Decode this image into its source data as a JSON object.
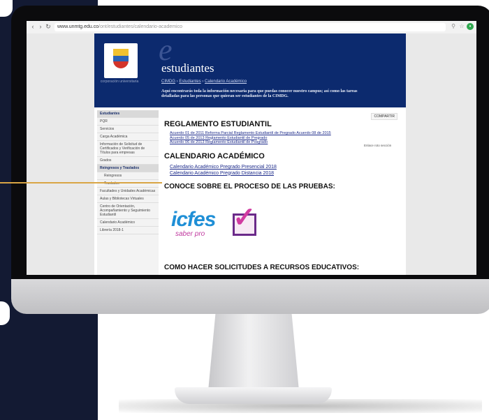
{
  "browser": {
    "url_domain": "www.unmtg.edu.co",
    "url_path": "/ont/estudiantes/calendario-academico"
  },
  "site": {
    "logo_caption": "corporación universitaria",
    "title": "estudiantes",
    "title_initial": "e",
    "breadcrumbs": [
      "CIMDG",
      "Estudiantes",
      "Calendario Académico"
    ],
    "intro": "Aquí encontrarás toda la información necesaria para que puedas conocer nuestro campus; así como las tareas detalladas para las personas que quieran ser estudiantes de la CIMDG."
  },
  "sidebar": {
    "items": [
      {
        "label": "Estudiantes",
        "type": "head"
      },
      {
        "label": "PQR",
        "type": "item"
      },
      {
        "label": "Servicios",
        "type": "item"
      },
      {
        "label": "Carga Académica",
        "type": "item"
      },
      {
        "label": "Información de Solicitud de Certificados y Verificación de Títulos para empresas",
        "type": "item"
      },
      {
        "label": "Grados",
        "type": "item"
      },
      {
        "label": "Reingresos y Traslados",
        "type": "head"
      },
      {
        "label": "Reingresos",
        "type": "sub"
      },
      {
        "label": "Traslados",
        "type": "sub"
      },
      {
        "label": "Facultades y Unidades Académicas",
        "type": "item"
      },
      {
        "label": "Aulas y Bibliotecas Virtuales",
        "type": "item"
      },
      {
        "label": "Centro de Orientación, Acompañamiento y Seguimiento Estudiantil",
        "type": "item"
      },
      {
        "label": "Calendario Académico",
        "type": "item"
      },
      {
        "label": "Librería 2018-1",
        "type": "item"
      }
    ]
  },
  "content": {
    "share_label": "COMPARTIR",
    "reglamento_title": "REGLAMENTO ESTUDIANTIL",
    "reglamento_links": [
      "Acuerdo 01 de 2011 Reforma Parcial Reglamento Estudiantil de Pregrado Acuerdo 08 de 2015",
      "Acuerdo 05 de 2013 Reglamento Estudiantil de Pregrado",
      "Acuerdo 06 de 2013 Reglamento Estudiantil de Posgrado"
    ],
    "aside_note": "Enlace roto sección",
    "calendario_title": "CALENDARIO ACADÉMICO",
    "calendario_links": [
      "Calendario Académico Pregrado Presencial 2018",
      "Calendario Académico Pregrado Distancia 2018"
    ],
    "pruebas_title": "CONOCE SOBRE EL PROCESO DE LAS PRUEBAS:",
    "icfes_word": "icfes",
    "icfes_sub": "saber pro",
    "solicitudes_title": "COMO HACER SOLICITUDES A RECURSOS EDUCATIVOS:"
  }
}
